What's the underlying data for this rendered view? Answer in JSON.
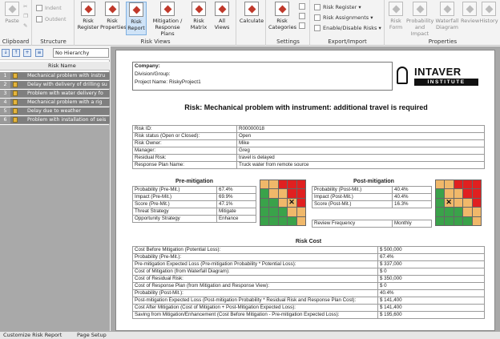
{
  "ribbon": {
    "clipboard": {
      "paste": "Paste",
      "group": "Clipboard"
    },
    "structure": {
      "indent": "Indent",
      "outdent": "Outdent",
      "group": "Structure"
    },
    "risk_views": {
      "group": "Risk Views",
      "buttons": [
        "Risk Register",
        "Risk Properties",
        "Risk Report",
        "Mitigation / Response Plans",
        "Risk Matrix",
        "All Views"
      ]
    },
    "calculate": "Calculate",
    "settings": {
      "group": "Settings",
      "risk_categories": "Risk Categories"
    },
    "export_import": {
      "group": "Export/Import",
      "items": [
        "Risk Register",
        "Risk Assignments",
        "Enable/Disable Risks"
      ]
    },
    "properties": {
      "group": "Properties",
      "buttons": [
        "Risk Form",
        "Probability and Impact",
        "Waterfall Diagram",
        "Review",
        "History"
      ]
    }
  },
  "left_panel": {
    "hierarchy": "No Hierarchy",
    "column": "Risk Name",
    "rows": [
      {
        "num": "1",
        "name": "Mechanical problem with instru"
      },
      {
        "num": "2",
        "name": "Delay with delivery of drilling su"
      },
      {
        "num": "3",
        "name": "Problem with water delivery fo"
      },
      {
        "num": "4",
        "name": "Mechanical problem with a rig"
      },
      {
        "num": "5",
        "name": "Delay due to weather"
      },
      {
        "num": "6",
        "name": "Problem with installation of seis"
      }
    ]
  },
  "bottom_tabs": {
    "customize": "Customize Risk Report",
    "page_setup": "Page Setup"
  },
  "report": {
    "company_label": "Company:",
    "division_label": "Division/Group:",
    "project_label": "Project Name: RiskyProject1",
    "logo_brand": "INTAVER",
    "logo_sub": "INSTITUTE",
    "title": "Risk: Mechanical problem with instrument: additional travel is required",
    "info": [
      [
        "Risk ID:",
        "R00000018"
      ],
      [
        "Risk status (Open or Closed):",
        "Open"
      ],
      [
        "Risk Owner:",
        "Mike"
      ],
      [
        "Manager:",
        "Greg"
      ],
      [
        "Residual Risk:",
        "travel is delayed"
      ],
      [
        "Response Plan Name:",
        "Truck water from remote source"
      ]
    ],
    "pre_title": "Pre-mitigation",
    "pre": [
      [
        "Probability (Pre-Mit.)",
        "67.4%"
      ],
      [
        "Impact (Pre-Mit.)",
        "69.9%"
      ],
      [
        "Score (Pre-Mit.)",
        "47.1%"
      ],
      [
        "Threat Strategy",
        "Mitigate"
      ],
      [
        "Opportunity Strategy",
        "Enhance"
      ]
    ],
    "post_title": "Post-mitigation",
    "post": [
      [
        "Probability (Post-Mit.)",
        "40.4%"
      ],
      [
        "Impact (Post-Mit.)",
        "40.4%"
      ],
      [
        "Score (Post-Mit.)",
        "16.3%"
      ],
      [
        "Review Frequency",
        "Monthly"
      ]
    ],
    "matrix_colors": {
      "green": "#3aa24a",
      "yellow": "#f0b86a",
      "red": "#e02020"
    },
    "cost_title": "Risk Cost",
    "cost": [
      [
        "Cost Before Mitigation (Potential Loss):",
        "$ 500,000"
      ],
      [
        "Probability (Pre-Mit.):",
        "67.4%"
      ],
      [
        "Pre-mitigation Expected Loss (Pre-mitigation Probability * Potential Loss):",
        "$ 337,000"
      ],
      [
        "Cost of Mitigation (from Waterfall Diagram):",
        "$ 0"
      ],
      [
        "Cost of Residual Risk:",
        "$ 350,000"
      ],
      [
        "Cost of Response Plan (from Mitigation and Response View):",
        "$ 0"
      ],
      [
        "Probability (Post-Mit.):",
        "40.4%"
      ],
      [
        "Post-mitigation Expected Loss (Post-mitigation Probability * Residual Risk and Response Plan Cost):",
        "$ 141,400"
      ],
      [
        "Cost After Mitigation (Cost of Mitigation + Post-Mitigation Expected Loss):",
        "$ 141,400"
      ],
      [
        "Saving from Mitigation/Enhancement (Cost Before Mitigation - Pre-mitigation Expected Loss):",
        "$ 195,600"
      ]
    ]
  }
}
